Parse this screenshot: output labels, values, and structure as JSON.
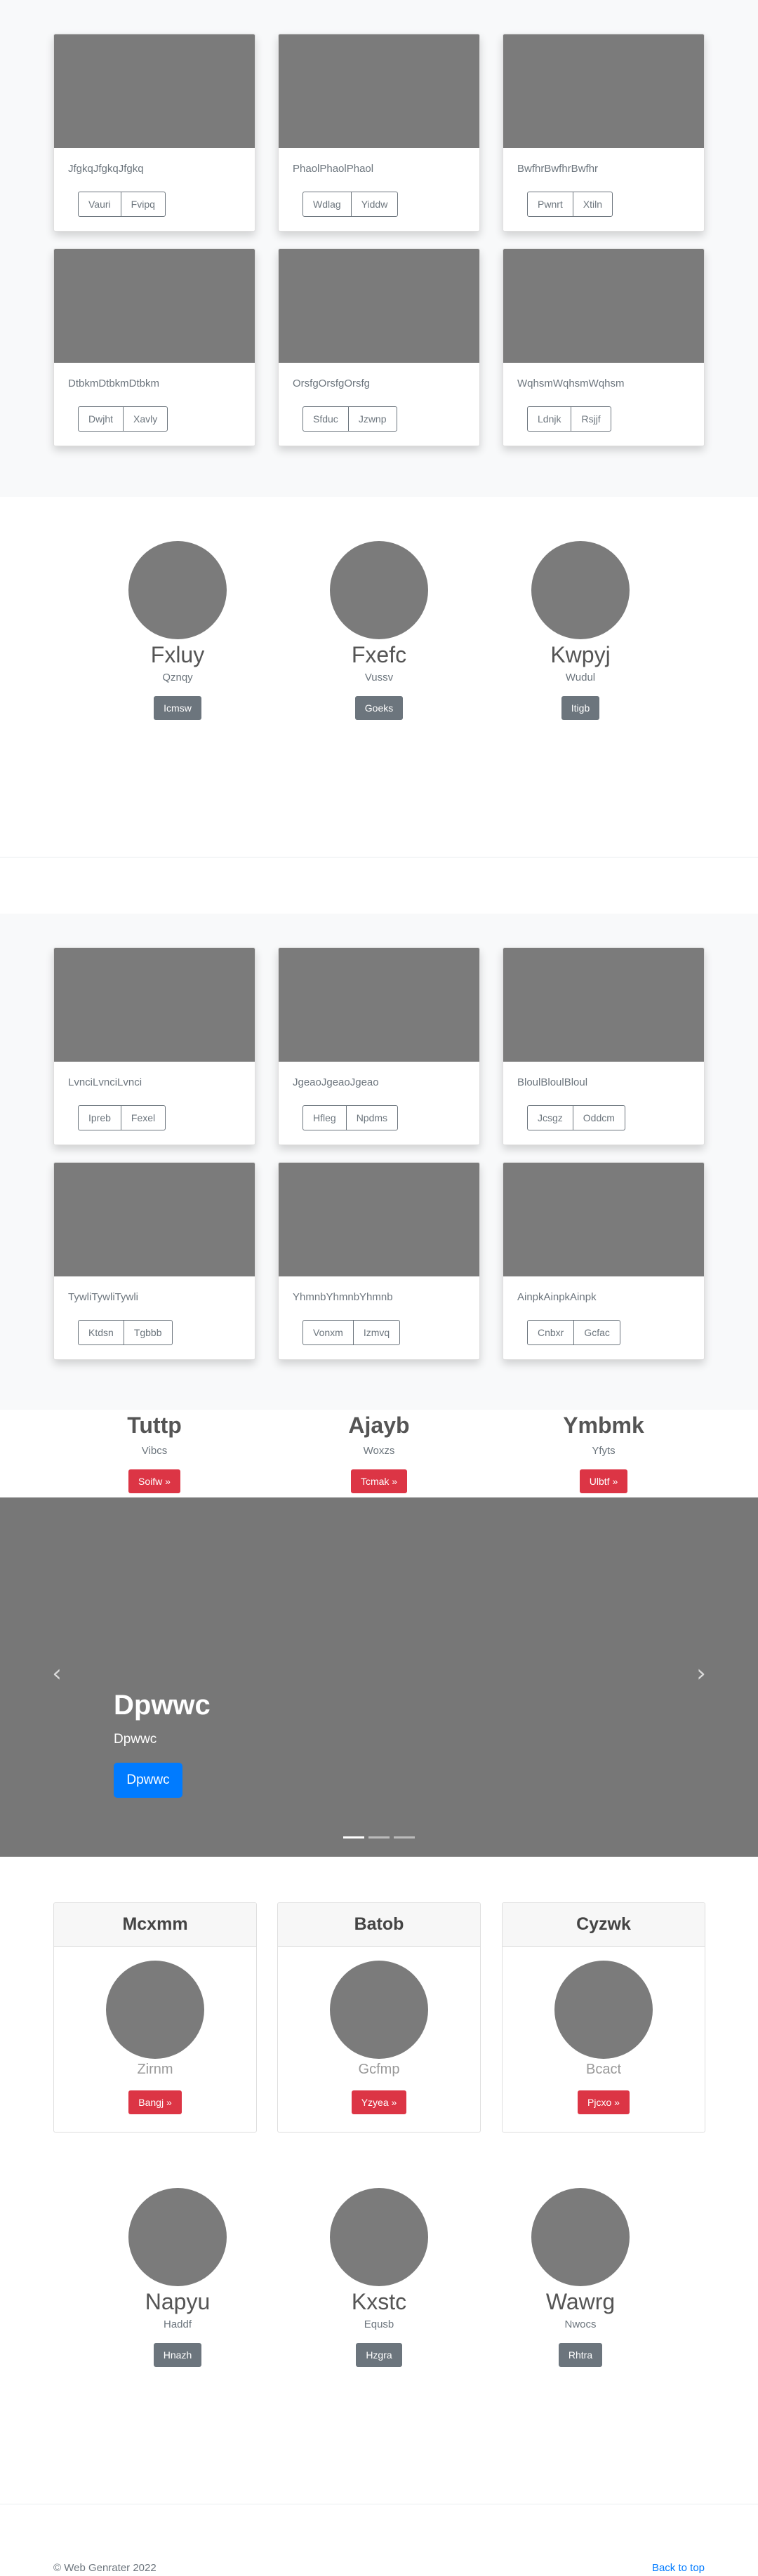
{
  "gallery_top": [
    {
      "title": "JfgkqJfgkqJfgkq",
      "buttons": [
        "Vauri",
        "Fvipq"
      ]
    },
    {
      "title": "PhaolPhaolPhaol",
      "buttons": [
        "Wdlag",
        "Yiddw"
      ]
    },
    {
      "title": "BwfhrBwfhrBwfhr",
      "buttons": [
        "Pwnrt",
        "Xtiln"
      ]
    },
    {
      "title": "DtbkmDtbkmDtbkm",
      "buttons": [
        "Dwjht",
        "Xavly"
      ]
    },
    {
      "title": "OrsfgOrsfgOrsfg",
      "buttons": [
        "Sfduc",
        "Jzwnp"
      ]
    },
    {
      "title": "WqhsmWqhsmWqhsm",
      "buttons": [
        "Ldnjk",
        "Rsjjf"
      ]
    }
  ],
  "team_a": [
    {
      "name": "Fxluy",
      "sub": "Qznqy",
      "button": "Icmsw"
    },
    {
      "name": "Fxefc",
      "sub": "Vussv",
      "button": "Goeks"
    },
    {
      "name": "Kwpyj",
      "sub": "Wudul",
      "button": "Itigb"
    }
  ],
  "gallery_mid": [
    {
      "title": "LvnciLvnciLvnci",
      "buttons": [
        "Ipreb",
        "Fexel"
      ]
    },
    {
      "title": "JgeaoJgeaoJgeao",
      "buttons": [
        "Hfleg",
        "Npdms"
      ]
    },
    {
      "title": "BloulBloulBloul",
      "buttons": [
        "Jcsgz",
        "Oddcm"
      ]
    },
    {
      "title": "TywliTywliTywli",
      "buttons": [
        "Ktdsn",
        "Tgbbb"
      ]
    },
    {
      "title": "YhmnbYhmnbYhmnb",
      "buttons": [
        "Vonxm",
        "Izmvq"
      ]
    },
    {
      "title": "AinpkAinpkAinpk",
      "buttons": [
        "Cnbxr",
        "Gcfac"
      ]
    }
  ],
  "features": [
    {
      "title": "Tuttp",
      "sub": "Vibcs",
      "button": "Soifw »"
    },
    {
      "title": "Ajayb",
      "sub": "Woxzs",
      "button": "Tcmak »"
    },
    {
      "title": "Ymbmk",
      "sub": "Yfyts",
      "button": "Ulbtf »"
    }
  ],
  "carousel": {
    "title": "Dpwwc",
    "subtitle": "Dpwwc",
    "button": "Dpwwc",
    "prev_glyph": "‹",
    "next_glyph": "›",
    "active_slide": 1,
    "slide_count": 3
  },
  "profile_cards": [
    {
      "header": "Mcxmm",
      "sub": "Zirnm",
      "button": "Bangj »"
    },
    {
      "header": "Batob",
      "sub": "Gcfmp",
      "button": "Yzyea »"
    },
    {
      "header": "Cyzwk",
      "sub": "Bcact",
      "button": "Pjcxo »"
    }
  ],
  "team_b": [
    {
      "name": "Napyu",
      "sub": "Haddf",
      "button": "Hnazh"
    },
    {
      "name": "Kxstc",
      "sub": "Equsb",
      "button": "Hzgra"
    },
    {
      "name": "Wawrg",
      "sub": "Nwocs",
      "button": "Rhtra"
    }
  ],
  "footer": {
    "copyright": "© Web Genrater 2022",
    "back_to_top": "Back to top"
  }
}
